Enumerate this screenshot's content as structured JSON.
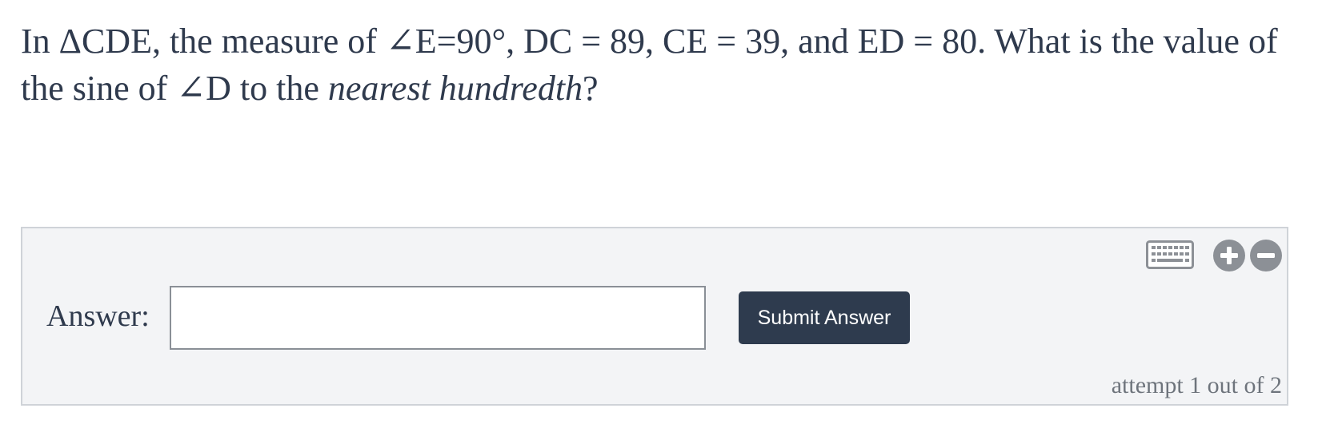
{
  "question": {
    "part1": "In ΔCDE, the measure of ∠E=90°, DC = 89, CE = 39, and ED = 80. What is the value of the sine of ∠D to the ",
    "emphasis": "nearest hundredth",
    "part2": "?"
  },
  "answer": {
    "label": "Answer:",
    "value": "",
    "submit_label": "Submit Answer"
  },
  "toolbar": {
    "keyboard_icon": "keyboard-icon",
    "zoom_in_icon": "plus-circle-icon",
    "zoom_out_icon": "minus-circle-icon"
  },
  "attempt": {
    "text": "attempt 1 out of 2"
  },
  "colors": {
    "text": "#2f3a4d",
    "panel_bg": "#f3f4f6",
    "button_bg": "#2e3b4e",
    "icon_gray": "#8c9096"
  }
}
